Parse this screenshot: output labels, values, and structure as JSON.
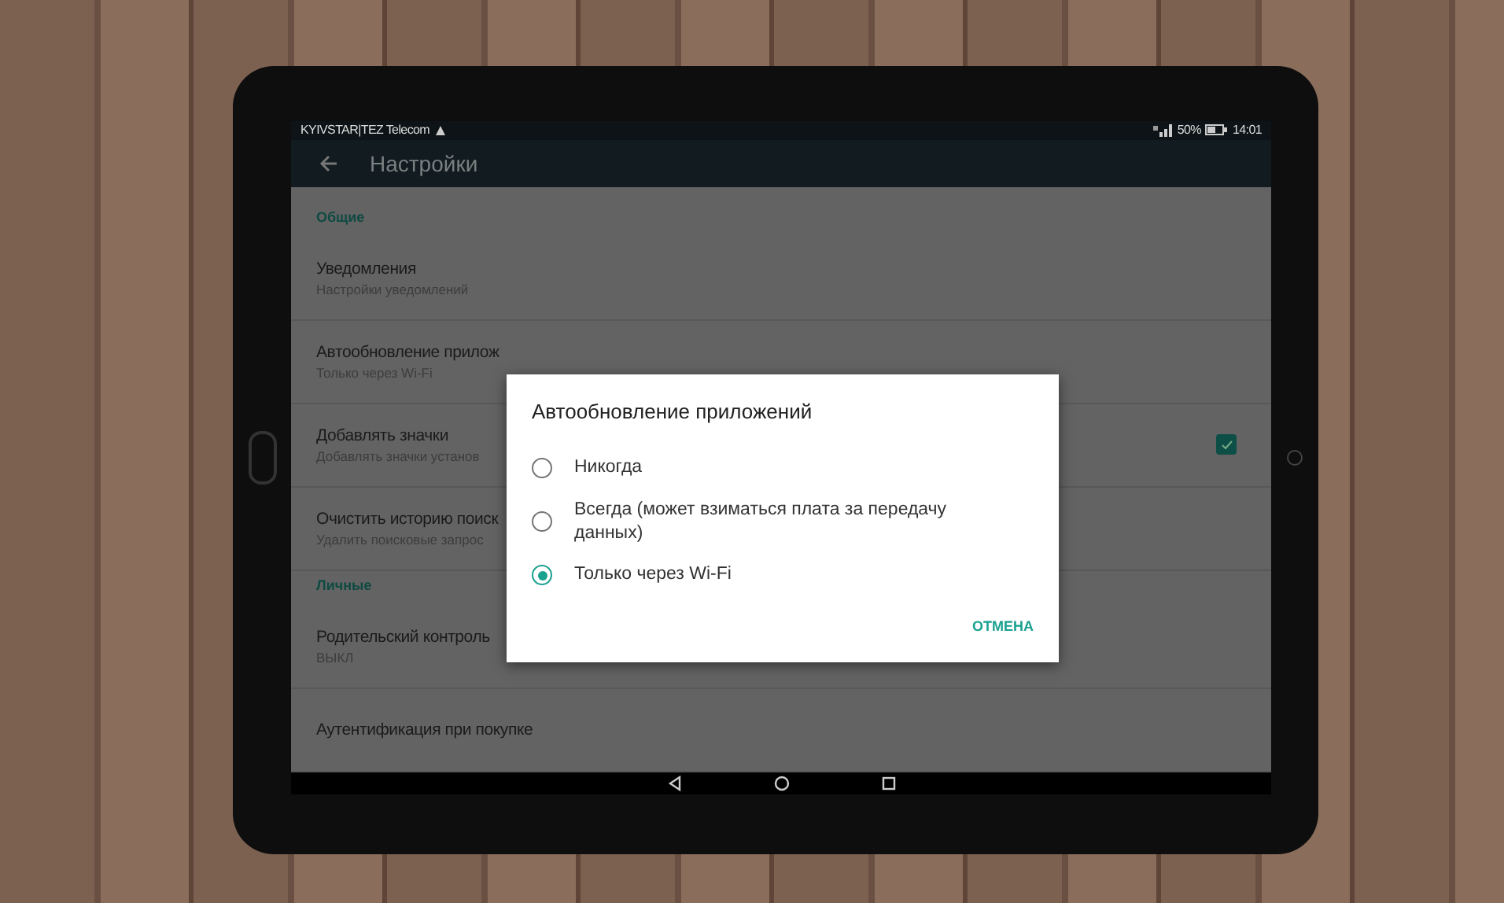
{
  "status_bar": {
    "carrier": "KYIVSTAR|TEZ Telecom",
    "battery": "50%",
    "time": "14:01"
  },
  "app_bar": {
    "title": "Настройки"
  },
  "sections": [
    {
      "header": "Общие",
      "items": [
        {
          "kind": "text",
          "title": "Уведомления",
          "subtitle": "Настройки уведомлений"
        },
        {
          "kind": "text",
          "title": "Автообновление прилож",
          "subtitle": "Только через Wi-Fi"
        },
        {
          "kind": "checkbox",
          "title": "Добавлять значки",
          "subtitle": "Добавлять значки установ",
          "checked": true
        },
        {
          "kind": "text",
          "title": "Очистить историю поиск",
          "subtitle": "Удалить поисковые запрос"
        }
      ]
    },
    {
      "header": "Личные",
      "items": [
        {
          "kind": "text",
          "title": "Родительский контроль",
          "subtitle": "ВЫКЛ"
        },
        {
          "kind": "text",
          "title": "Аутентификация при покупке"
        }
      ]
    }
  ],
  "dialog": {
    "title": "Автообновление приложений",
    "options": [
      {
        "label": "Никогда",
        "selected": false
      },
      {
        "label": "Всегда (может взиматься плата за передачу данных)",
        "selected": false
      },
      {
        "label": "Только через Wi-Fi",
        "selected": true
      }
    ],
    "button": "ОТМЕНА"
  }
}
